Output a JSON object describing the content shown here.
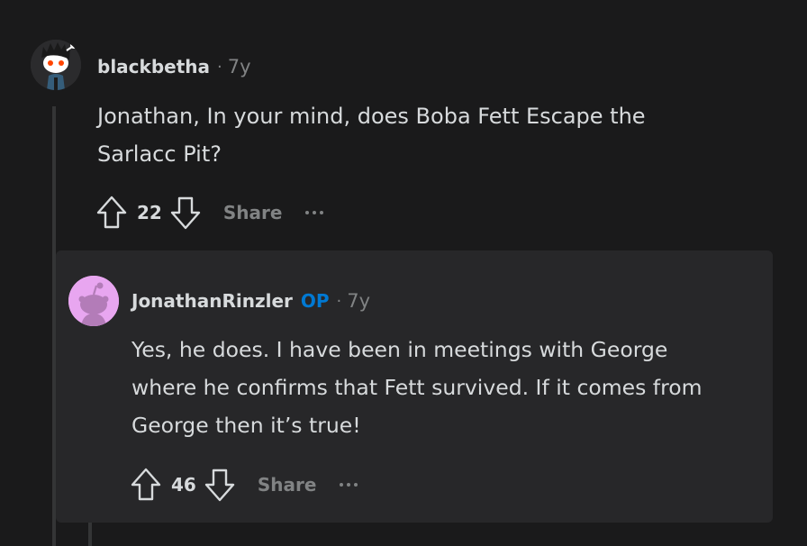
{
  "comment": {
    "author": "blackbetha",
    "age": "7y",
    "body_lines": [
      "Jonathan, In your mind, does Boba Fett Escape the",
      "Sarlacc Pit?"
    ],
    "score": "22",
    "share_label": "Share"
  },
  "reply": {
    "author": "JonathanRinzler",
    "badge": "OP",
    "age": "7y",
    "body_lines": [
      "Yes, he does. I have been in meetings with George",
      "where he confirms that Fett survived. If it comes from",
      "George then it’s true!"
    ],
    "score": "46",
    "share_label": "Share"
  },
  "separator": "·",
  "icons": {
    "upvote": "upvote-arrow-icon",
    "downvote": "downvote-arrow-icon",
    "more": "more-options-icon"
  },
  "colors": {
    "background": "#1a1a1b",
    "card": "#272729",
    "op_badge": "#0079d3",
    "muted": "#818384",
    "reply_avatar_bg": "#e8a6f0"
  }
}
